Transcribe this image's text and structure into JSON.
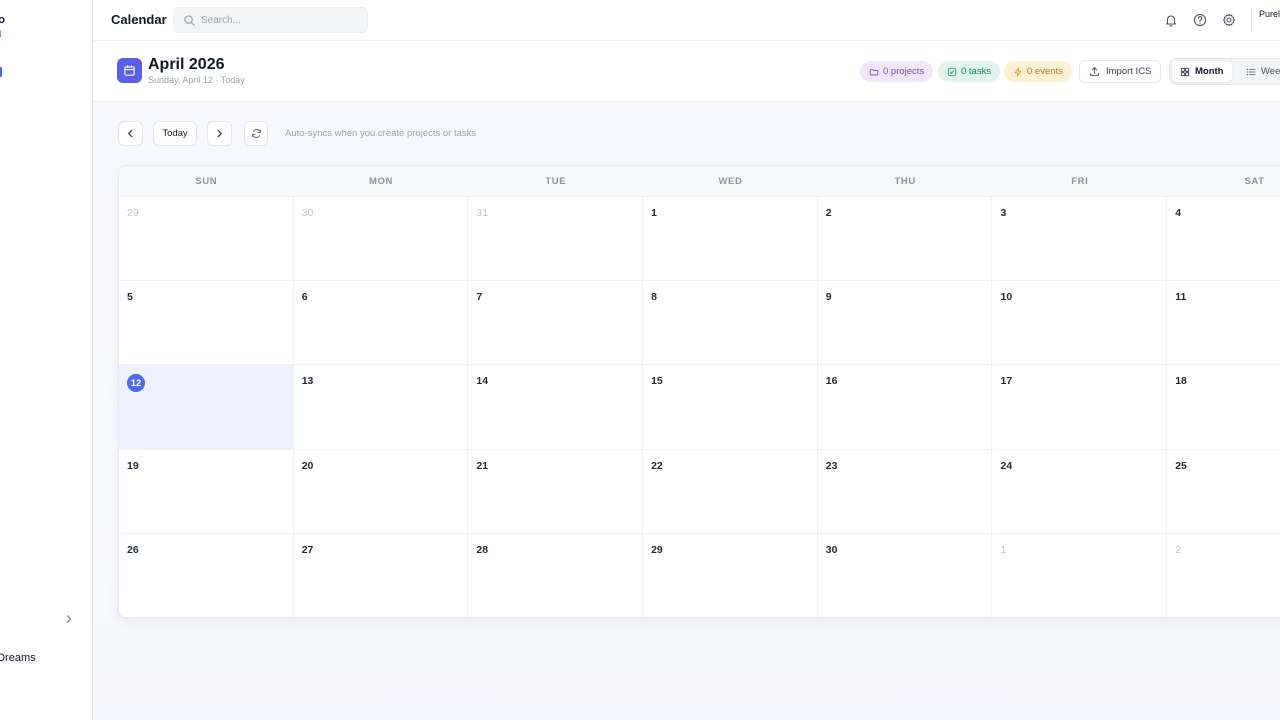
{
  "sidebar": {
    "brand_fragment": "ro",
    "brand_sub_fragment": "N",
    "user_fragment": "oDreams"
  },
  "topbar": {
    "title": "Calendar",
    "search_placeholder": "Search...",
    "user_fragment": "Purel"
  },
  "header": {
    "title": "April 2026",
    "subtitle": "Sunday, April 12 · Today",
    "projects_label": "0 projects",
    "tasks_label": "0 tasks",
    "events_label": "0 events",
    "import_label": "Import ICS",
    "view_month_label": "Month",
    "view_week_label": "Week",
    "active_view": "Month"
  },
  "toolbar": {
    "today_label": "Today",
    "sync_note": "Auto-syncs when you create projects or tasks"
  },
  "calendar": {
    "weekdays": [
      "SUN",
      "MON",
      "TUE",
      "WED",
      "THU",
      "FRI",
      "SAT"
    ],
    "weeks": [
      [
        {
          "day": "29",
          "muted": true
        },
        {
          "day": "30",
          "muted": true
        },
        {
          "day": "31",
          "muted": true
        },
        {
          "day": "1"
        },
        {
          "day": "2"
        },
        {
          "day": "3"
        },
        {
          "day": "4"
        }
      ],
      [
        {
          "day": "5"
        },
        {
          "day": "6"
        },
        {
          "day": "7"
        },
        {
          "day": "8"
        },
        {
          "day": "9"
        },
        {
          "day": "10"
        },
        {
          "day": "11"
        }
      ],
      [
        {
          "day": "12",
          "today": true
        },
        {
          "day": "13"
        },
        {
          "day": "14"
        },
        {
          "day": "15"
        },
        {
          "day": "16"
        },
        {
          "day": "17"
        },
        {
          "day": "18"
        }
      ],
      [
        {
          "day": "19"
        },
        {
          "day": "20"
        },
        {
          "day": "21"
        },
        {
          "day": "22"
        },
        {
          "day": "23"
        },
        {
          "day": "24"
        },
        {
          "day": "25"
        }
      ],
      [
        {
          "day": "26"
        },
        {
          "day": "27"
        },
        {
          "day": "28"
        },
        {
          "day": "29"
        },
        {
          "day": "30"
        },
        {
          "day": "1",
          "muted": true
        },
        {
          "day": "2",
          "muted": true
        }
      ]
    ]
  },
  "colors": {
    "accent": "#4f6bed",
    "calendar_badge": "#5b5ee8",
    "today_bg": "#ecf1fd",
    "projects_pill": "#efe8fb",
    "tasks_pill": "#dff5ea",
    "events_pill": "#fdf1d4"
  },
  "icons": {
    "calendar_badge": "calendar-icon",
    "search": "search-icon",
    "notifications": "bell-icon",
    "help": "help-circle-icon",
    "settings": "gear-icon",
    "projects": "folder-icon",
    "tasks": "check-square-icon",
    "events": "bolt-icon",
    "import": "upload-icon",
    "month_view": "grid-icon",
    "week_view": "list-icon",
    "prev": "chevron-left-icon",
    "next": "chevron-right-icon",
    "sync": "refresh-icon",
    "collapse": "chevron-right-icon"
  }
}
